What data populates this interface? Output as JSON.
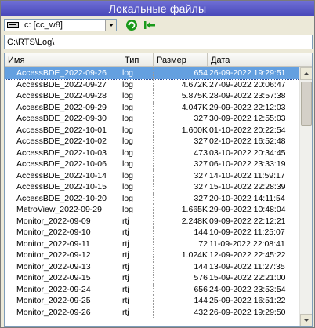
{
  "window": {
    "title": "Локальные файлы"
  },
  "toolbar": {
    "drive_value": "c: [cc_w8]",
    "refresh_icon": "refresh-icon",
    "back_icon": "go-up-icon"
  },
  "path": {
    "value": "C:\\RTS\\Log\\"
  },
  "columns": {
    "name": "Имя",
    "type": "Тип",
    "size": "Размер",
    "date": "Дата"
  },
  "colors": {
    "title_bg": "#5656c6",
    "selection": "#64a0e0",
    "accent_green": "#1a9a1a"
  },
  "files": [
    {
      "name": "AccessBDE_2022-09-26",
      "type": "log",
      "size": "654",
      "date": "26-09-2022 19:29:51",
      "selected": true
    },
    {
      "name": "AccessBDE_2022-09-27",
      "type": "log",
      "size": "4.672K",
      "date": "27-09-2022 20:06:47"
    },
    {
      "name": "AccessBDE_2022-09-28",
      "type": "log",
      "size": "5.875K",
      "date": "28-09-2022 23:57:38"
    },
    {
      "name": "AccessBDE_2022-09-29",
      "type": "log",
      "size": "4.047K",
      "date": "29-09-2022 22:12:03"
    },
    {
      "name": "AccessBDE_2022-09-30",
      "type": "log",
      "size": "327",
      "date": "30-09-2022 12:55:03"
    },
    {
      "name": "AccessBDE_2022-10-01",
      "type": "log",
      "size": "1.600K",
      "date": "01-10-2022 20:22:54"
    },
    {
      "name": "AccessBDE_2022-10-02",
      "type": "log",
      "size": "327",
      "date": "02-10-2022 16:52:48"
    },
    {
      "name": "AccessBDE_2022-10-03",
      "type": "log",
      "size": "473",
      "date": "03-10-2022 20:34:45"
    },
    {
      "name": "AccessBDE_2022-10-06",
      "type": "log",
      "size": "327",
      "date": "06-10-2022 23:33:19"
    },
    {
      "name": "AccessBDE_2022-10-14",
      "type": "log",
      "size": "327",
      "date": "14-10-2022 11:59:17"
    },
    {
      "name": "AccessBDE_2022-10-15",
      "type": "log",
      "size": "327",
      "date": "15-10-2022 22:28:39"
    },
    {
      "name": "AccessBDE_2022-10-20",
      "type": "log",
      "size": "327",
      "date": "20-10-2022 14:11:54"
    },
    {
      "name": "MetroView_2022-09-29",
      "type": "log",
      "size": "1.665K",
      "date": "29-09-2022 10:48:04"
    },
    {
      "name": "Monitor_2022-09-09",
      "type": "rtj",
      "size": "2.248K",
      "date": "09-09-2022 22:12:21"
    },
    {
      "name": "Monitor_2022-09-10",
      "type": "rtj",
      "size": "144",
      "date": "10-09-2022 11:25:07"
    },
    {
      "name": "Monitor_2022-09-11",
      "type": "rtj",
      "size": "72",
      "date": "11-09-2022 22:08:41"
    },
    {
      "name": "Monitor_2022-09-12",
      "type": "rtj",
      "size": "1.024K",
      "date": "12-09-2022 22:45:22"
    },
    {
      "name": "Monitor_2022-09-13",
      "type": "rtj",
      "size": "144",
      "date": "13-09-2022 11:27:35"
    },
    {
      "name": "Monitor_2022-09-15",
      "type": "rtj",
      "size": "576",
      "date": "15-09-2022 22:21:00"
    },
    {
      "name": "Monitor_2022-09-24",
      "type": "rtj",
      "size": "656",
      "date": "24-09-2022 23:53:54"
    },
    {
      "name": "Monitor_2022-09-25",
      "type": "rtj",
      "size": "144",
      "date": "25-09-2022 16:51:22"
    },
    {
      "name": "Monitor_2022-09-26",
      "type": "rtj",
      "size": "432",
      "date": "26-09-2022 19:29:50"
    }
  ]
}
